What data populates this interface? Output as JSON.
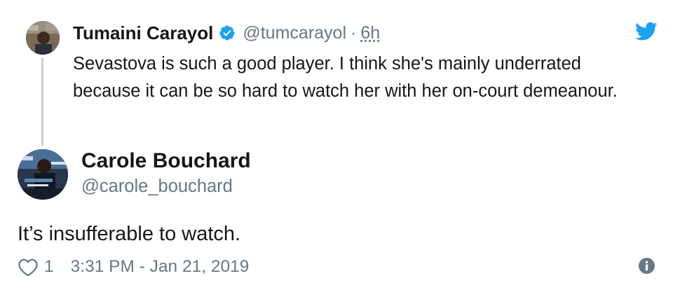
{
  "parent_tweet": {
    "author_name": "Tumaini Carayol",
    "author_handle": "@tumcarayol",
    "separator": "·",
    "time": "6h",
    "text": "Sevastova is such a good player. I think she's mainly underrated because it can be so hard to watch her with her on-court demeanour.",
    "verified": true
  },
  "main_tweet": {
    "author_name": "Carole Bouchard",
    "author_handle": "@carole_bouchard",
    "text": "It’s insufferable to watch.",
    "like_count": "1",
    "timestamp": "3:31 PM - Jan 21, 2019"
  },
  "icons": {
    "verified": "verified-badge-icon",
    "brand": "twitter-bird-icon",
    "like": "heart-icon",
    "info": "info-icon"
  },
  "colors": {
    "brand_blue": "#1da1f2",
    "text_primary": "#14171a",
    "text_secondary": "#657786",
    "thread_line": "#c4cfd6"
  }
}
